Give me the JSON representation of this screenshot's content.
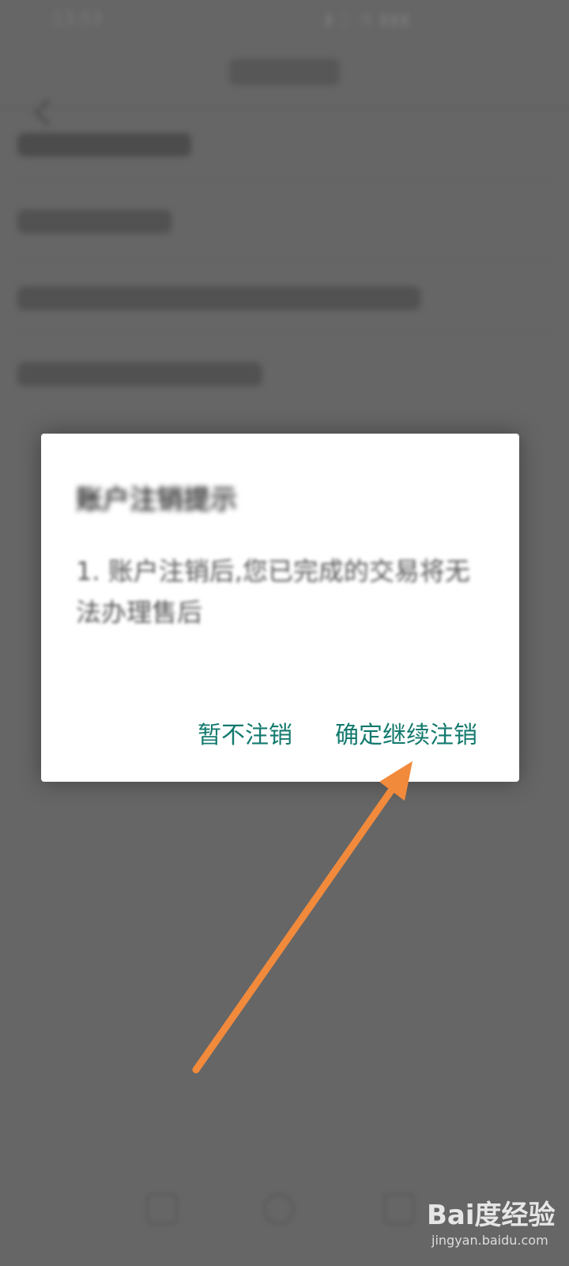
{
  "status_bar": {
    "time": "13:53"
  },
  "header": {
    "back_icon": "chevron-left-icon"
  },
  "dialog": {
    "title": "账户注销提示",
    "body": "1. 账户注销后,您已完成的交易将无法办理售后",
    "buttons": {
      "cancel": "暂不注销",
      "confirm": "确定继续注销"
    },
    "accent_color": "#137a6e"
  },
  "annotation": {
    "arrow_color": "#f28a3c"
  },
  "watermark": {
    "logo": "Bai度经验",
    "url": "jingyan.baidu.com"
  }
}
